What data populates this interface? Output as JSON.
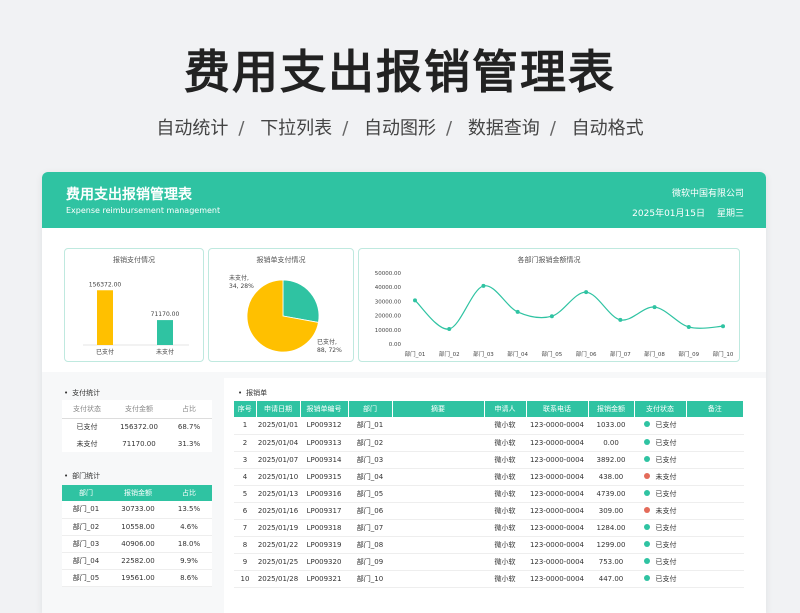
{
  "hero": {
    "title": "费用支出报销管理表",
    "features": [
      "自动统计",
      "下拉列表",
      "自动图形",
      "数据查询",
      "自动格式"
    ]
  },
  "banner": {
    "title": "费用支出报销管理表",
    "subtitle": "Expense reimbursement management",
    "company": "微软中国有限公司",
    "date": "2025年01月15日",
    "weekday": "星期三"
  },
  "colors": {
    "accent": "#2fc3a2",
    "bar": "#ffc000",
    "paid": "#2fc3a2",
    "unpaid": "#e46b5a"
  },
  "chart_data": [
    {
      "type": "bar",
      "title": "报销支付情况",
      "categories": [
        "已支付",
        "未支付"
      ],
      "values": [
        156372.0,
        71170.0
      ],
      "value_labels": [
        "156372.00",
        "71170.00"
      ],
      "colors": [
        "#ffc000",
        "#2fc3a2"
      ]
    },
    {
      "type": "pie",
      "title": "报销单支付情况",
      "labels": [
        "未支付,",
        "已支付,"
      ],
      "label_values": [
        "34, 28%",
        "88, 72%"
      ],
      "values": [
        34,
        88
      ],
      "colors": [
        "#2fc3a2",
        "#ffc000"
      ]
    },
    {
      "type": "line",
      "title": "各部门报销金额情况",
      "categories": [
        "部门_01",
        "部门_02",
        "部门_03",
        "部门_04",
        "部门_05",
        "部门_06",
        "部门_07",
        "部门_08",
        "部门_09",
        "部门_10"
      ],
      "values": [
        30733,
        10558,
        40906,
        22582,
        19561,
        36500,
        17000,
        26000,
        12000,
        12500
      ],
      "yticks": [
        "50000.00",
        "40000.00",
        "30000.00",
        "20000.00",
        "10000.00",
        "0.00"
      ],
      "ylim": [
        0,
        50000
      ]
    }
  ],
  "pay_stats": {
    "title": "支付统计",
    "headers": [
      "支付状态",
      "支付金额",
      "占比"
    ],
    "rows": [
      [
        "已支付",
        "156372.00",
        "68.7%"
      ],
      [
        "未支付",
        "71170.00",
        "31.3%"
      ]
    ]
  },
  "dept_stats": {
    "title": "部门统计",
    "headers": [
      "部门",
      "报销金额",
      "占比"
    ],
    "rows": [
      [
        "部门_01",
        "30733.00",
        "13.5%"
      ],
      [
        "部门_02",
        "10558.00",
        "4.6%"
      ],
      [
        "部门_03",
        "40906.00",
        "18.0%"
      ],
      [
        "部门_04",
        "22582.00",
        "9.9%"
      ],
      [
        "部门_05",
        "19561.00",
        "8.6%"
      ]
    ]
  },
  "main_table": {
    "title": "报销单",
    "headers": [
      "序号",
      "申请日期",
      "报销单编号",
      "部门",
      "摘要",
      "申请人",
      "联系电话",
      "报销金额",
      "支付状态",
      "备注"
    ],
    "rows": [
      [
        "1",
        "2025/01/01",
        "LP009312",
        "部门_01",
        "",
        "微小软",
        "123-0000-0004",
        "1033.00",
        "已支付"
      ],
      [
        "2",
        "2025/01/04",
        "LP009313",
        "部门_02",
        "",
        "微小软",
        "123-0000-0004",
        "0.00",
        "已支付"
      ],
      [
        "3",
        "2025/01/07",
        "LP009314",
        "部门_03",
        "",
        "微小软",
        "123-0000-0004",
        "3892.00",
        "已支付"
      ],
      [
        "4",
        "2025/01/10",
        "LP009315",
        "部门_04",
        "",
        "微小软",
        "123-0000-0004",
        "438.00",
        "未支付"
      ],
      [
        "5",
        "2025/01/13",
        "LP009316",
        "部门_05",
        "",
        "微小软",
        "123-0000-0004",
        "4739.00",
        "已支付"
      ],
      [
        "6",
        "2025/01/16",
        "LP009317",
        "部门_06",
        "",
        "微小软",
        "123-0000-0004",
        "309.00",
        "未支付"
      ],
      [
        "7",
        "2025/01/19",
        "LP009318",
        "部门_07",
        "",
        "微小软",
        "123-0000-0004",
        "1284.00",
        "已支付"
      ],
      [
        "8",
        "2025/01/22",
        "LP009319",
        "部门_08",
        "",
        "微小软",
        "123-0000-0004",
        "1299.00",
        "已支付"
      ],
      [
        "9",
        "2025/01/25",
        "LP009320",
        "部门_09",
        "",
        "微小软",
        "123-0000-0004",
        "753.00",
        "已支付"
      ],
      [
        "10",
        "2025/01/28",
        "LP009321",
        "部门_10",
        "",
        "微小软",
        "123-0000-0004",
        "447.00",
        "已支付"
      ]
    ]
  }
}
